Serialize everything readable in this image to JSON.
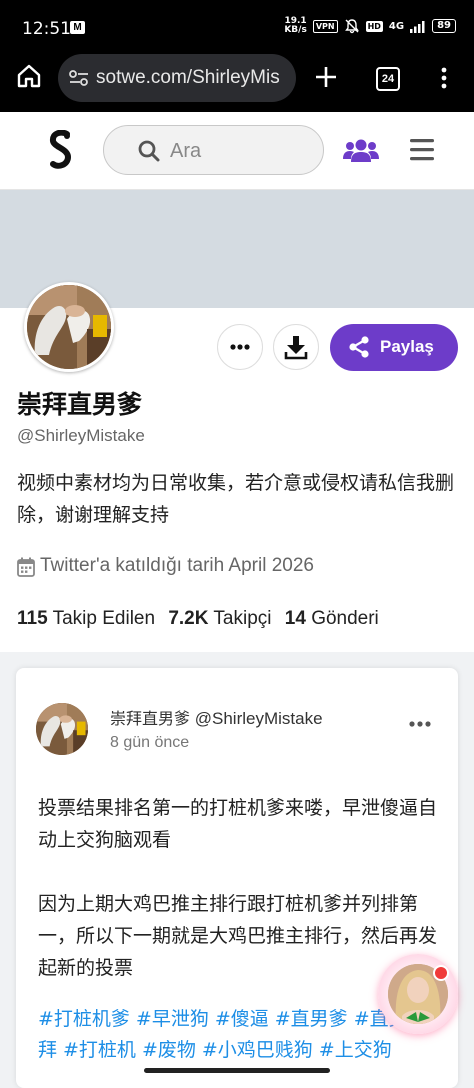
{
  "status_bar": {
    "time": "12:51",
    "speed_top": "19.1",
    "speed_bottom": "KB/s",
    "vpn": "VPN",
    "hd": "HD",
    "network": "4G",
    "battery": "89"
  },
  "browser": {
    "url": "sotwe.com/ShirleyMis",
    "tab_count": "24"
  },
  "site_header": {
    "search_placeholder": "Ara"
  },
  "profile": {
    "display_name": "崇拜直男爹",
    "handle": "@ShirleyMistake",
    "bio": "视频中素材均为日常收集，若介意或侵权请私信我删除，谢谢理解支持",
    "joined": "Twitter'a katıldığı tarih April 2026",
    "share_label": "Paylaş",
    "stats": {
      "following_count": "115",
      "following_label": "Takip Edilen",
      "followers_count": "7.2K",
      "followers_label": "Takipçi",
      "posts_count": "14",
      "posts_label": "Gönderi"
    }
  },
  "tweet": {
    "author_name": "崇拜直男爹",
    "author_handle": "@ShirleyMistake",
    "time": "8 gün önce",
    "paragraph1": "投票结果排名第一的打桩机爹来喽，早泄傻逼自动上交狗脑观看",
    "paragraph2": "因为上期大鸡巴推主排行跟打桩机爹并列排第一，所以下一期就是大鸡巴推主排行，然后再发起新的投票",
    "hashtags": [
      "#打桩机爹",
      "#早泄狗",
      "#傻逼",
      "#直男爹",
      "#直男",
      "崇拜",
      "#打桩机",
      "#废物",
      "#小鸡巴贱狗",
      "#上交狗"
    ]
  },
  "colors": {
    "accent_purple": "#6d3cc9",
    "hashtag_blue": "#1d8ee6",
    "cover_gray": "#d4dbe1"
  }
}
